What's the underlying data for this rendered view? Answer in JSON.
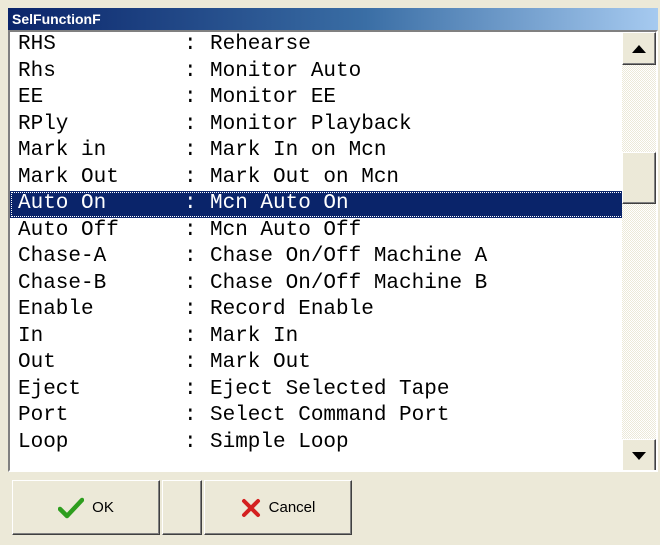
{
  "window": {
    "title": "SelFunctionF"
  },
  "list": {
    "items": [
      {
        "code": "RHS",
        "desc": "Rehearse"
      },
      {
        "code": "Rhs",
        "desc": "Monitor Auto"
      },
      {
        "code": "EE",
        "desc": "Monitor EE"
      },
      {
        "code": "RPly",
        "desc": "Monitor Playback"
      },
      {
        "code": "Mark in",
        "desc": "Mark In on Mcn"
      },
      {
        "code": "Mark Out",
        "desc": "Mark Out on Mcn"
      },
      {
        "code": "Auto On",
        "desc": "Mcn Auto On"
      },
      {
        "code": "Auto Off",
        "desc": "Mcn Auto Off"
      },
      {
        "code": "Chase-A",
        "desc": "Chase On/Off Machine A"
      },
      {
        "code": "Chase-B",
        "desc": "Chase On/Off Machine B"
      },
      {
        "code": "Enable",
        "desc": "Record Enable"
      },
      {
        "code": "In",
        "desc": "Mark In"
      },
      {
        "code": "Out",
        "desc": "Mark Out"
      },
      {
        "code": "Eject",
        "desc": "Eject Selected Tape"
      },
      {
        "code": "Port",
        "desc": "Select Command Port"
      },
      {
        "code": "Loop",
        "desc": "Simple Loop"
      }
    ],
    "selected_index": 6,
    "separator": ":"
  },
  "buttons": {
    "ok_label": "OK",
    "cancel_label": "Cancel",
    "ok_icon": "checkmark-icon",
    "cancel_icon": "x-icon"
  },
  "colors": {
    "selection_bg": "#0a246a",
    "title_bg_start": "#0a246a",
    "ok_icon": "#2e9e1e",
    "cancel_icon": "#d42020"
  }
}
